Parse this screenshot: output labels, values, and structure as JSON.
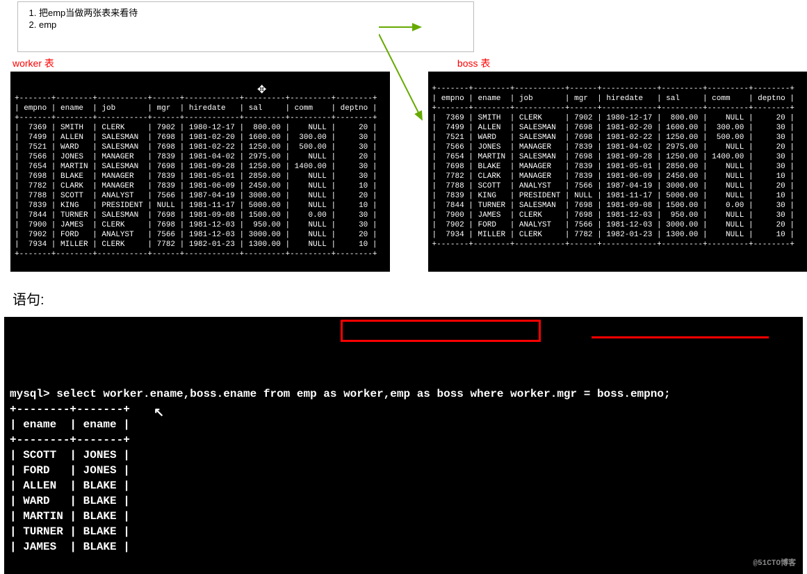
{
  "notes": {
    "item1": "把emp当做两张表来看待",
    "item2": "emp"
  },
  "labels": {
    "worker": "worker 表",
    "boss": "boss 表"
  },
  "table_header": "| empno | ename  | job       | mgr  | hiredate   | sal     | comm    | deptno |",
  "table_sep": "+-------+--------+-----------+------+------------+---------+---------+--------+",
  "worker_rows": [
    "|  7369 | SMITH  | CLERK     | 7902 | 1980-12-17 |  800.00 |    NULL |     20 |",
    "|  7499 | ALLEN  | SALESMAN  | 7698 | 1981-02-20 | 1600.00 |  300.00 |     30 |",
    "|  7521 | WARD   | SALESMAN  | 7698 | 1981-02-22 | 1250.00 |  500.00 |     30 |",
    "|  7566 | JONES  | MANAGER   | 7839 | 1981-04-02 | 2975.00 |    NULL |     20 |",
    "|  7654 | MARTIN | SALESMAN  | 7698 | 1981-09-28 | 1250.00 | 1400.00 |     30 |",
    "|  7698 | BLAKE  | MANAGER   | 7839 | 1981-05-01 | 2850.00 |    NULL |     30 |",
    "|  7782 | CLARK  | MANAGER   | 7839 | 1981-06-09 | 2450.00 |    NULL |     10 |",
    "|  7788 | SCOTT  | ANALYST   | 7566 | 1987-04-19 | 3000.00 |    NULL |     20 |",
    "|  7839 | KING   | PRESIDENT | NULL | 1981-11-17 | 5000.00 |    NULL |     10 |",
    "|  7844 | TURNER | SALESMAN  | 7698 | 1981-09-08 | 1500.00 |    0.00 |     30 |",
    "|  7900 | JAMES  | CLERK     | 7698 | 1981-12-03 |  950.00 |    NULL |     30 |",
    "|  7902 | FORD   | ANALYST   | 7566 | 1981-12-03 | 3000.00 |    NULL |     20 |",
    "|  7934 | MILLER | CLERK     | 7782 | 1982-01-23 | 1300.00 |    NULL |     10 |"
  ],
  "boss_rows": [
    "|  7369 | SMITH  | CLERK     | 7902 | 1980-12-17 |  800.00 |    NULL |     20 |",
    "|  7499 | ALLEN  | SALESMAN  | 7698 | 1981-02-20 | 1600.00 |  300.00 |     30 |",
    "|  7521 | WARD   | SALESMAN  | 7698 | 1981-02-22 | 1250.00 |  500.00 |     30 |",
    "|  7566 | JONES  | MANAGER   | 7839 | 1981-04-02 | 2975.00 |    NULL |     20 |",
    "|  7654 | MARTIN | SALESMAN  | 7698 | 1981-09-28 | 1250.00 | 1400.00 |     30 |",
    "|  7698 | BLAKE  | MANAGER   | 7839 | 1981-05-01 | 2850.00 |    NULL |     30 |",
    "|  7782 | CLARK  | MANAGER   | 7839 | 1981-06-09 | 2450.00 |    NULL |     10 |",
    "|  7788 | SCOTT  | ANALYST   | 7566 | 1987-04-19 | 3000.00 |    NULL |     20 |",
    "|  7839 | KING   | PRESIDENT | NULL | 1981-11-17 | 5000.00 |    NULL |     10 |",
    "|  7844 | TURNER | SALESMAN  | 7698 | 1981-09-08 | 1500.00 |    0.00 |     30 |",
    "|  7900 | JAMES  | CLERK     | 7698 | 1981-12-03 |  950.00 |    NULL |     30 |",
    "|  7902 | FORD   | ANALYST   | 7566 | 1981-12-03 | 3000.00 |    NULL |     20 |",
    "|  7934 | MILLER | CLERK     | 7782 | 1982-01-23 | 1300.00 |    NULL |     10 |"
  ],
  "section": "语句:",
  "sql": {
    "prompt": "mysql> select worker.ename,boss.ename from emp as worker,emp as boss where worker.mgr = boss.empno;",
    "sep": "+--------+-------+",
    "header": "| ename  | ename |",
    "rows": [
      "| SCOTT  | JONES |",
      "| FORD   | JONES |",
      "| ALLEN  | BLAKE |",
      "| WARD   | BLAKE |",
      "| MARTIN | BLAKE |",
      "| TURNER | BLAKE |",
      "| JAMES  | BLAKE |"
    ]
  },
  "watermark": "@51CTO博客"
}
